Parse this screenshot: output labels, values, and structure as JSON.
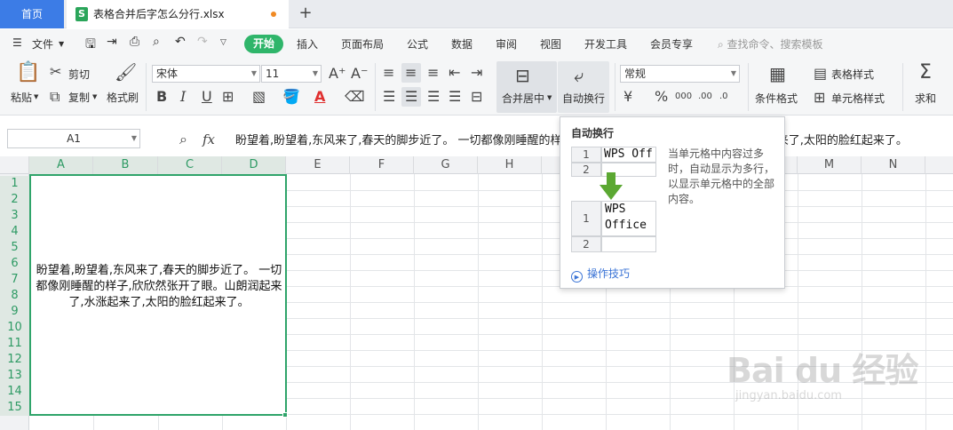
{
  "tabs": {
    "home": "首页",
    "file": "表格合并后字怎么分行.xlsx",
    "add": "+"
  },
  "menu": {
    "file": "文件",
    "start": "开始",
    "items": [
      "插入",
      "页面布局",
      "公式",
      "数据",
      "审阅",
      "视图",
      "开发工具",
      "会员专享"
    ],
    "search": "查找命令、搜索模板"
  },
  "ribbon": {
    "paste": "粘贴",
    "cut": "剪切",
    "copy": "复制",
    "format_painter": "格式刷",
    "font_name": "宋体",
    "font_size": "11",
    "merge_center": "合并居中",
    "wrap_text": "自动换行",
    "number_format": "常规",
    "cond_format": "条件格式",
    "table_style": "表格样式",
    "cell_style": "单元格样式",
    "sum": "求和"
  },
  "formula": {
    "cell_ref": "A1",
    "fx": "fx",
    "content": "盼望着,盼望着,东风来了,春天的脚步近了。 一切都像刚睡醒的样子,欣欣然张开了眼。山朗润起来了,水涨起来了,太阳的脸红起来了。"
  },
  "columns": [
    "A",
    "B",
    "C",
    "D",
    "E",
    "F",
    "G",
    "H",
    "I",
    "J",
    "K",
    "L",
    "M",
    "N"
  ],
  "rows": [
    "1",
    "2",
    "3",
    "4",
    "5",
    "6",
    "7",
    "8",
    "9",
    "10",
    "11",
    "12",
    "13",
    "14",
    "15"
  ],
  "cell_text": "盼望着,盼望着,东风来了,春天的脚步近了。 一切都像刚睡醒的样子,欣欣然张开了眼。山朗润起来了,水涨起来了,太阳的脸红起来了。",
  "tooltip": {
    "title": "自动换行",
    "description": "当单元格中内容过多时，自动显示为多行，以显示单元格中的全部内容。",
    "before_text": "WPS Off",
    "after_line1": "WPS",
    "after_line2": "Office",
    "row1": "1",
    "row2": "2",
    "tips": "操作技巧"
  },
  "watermark": {
    "logo": "Bai du 经验",
    "url": "jingyan.baidu.com"
  },
  "colors": {
    "accent": "#2fb56a",
    "home_tab": "#3c7ce6",
    "selection": "#2fa46a"
  }
}
